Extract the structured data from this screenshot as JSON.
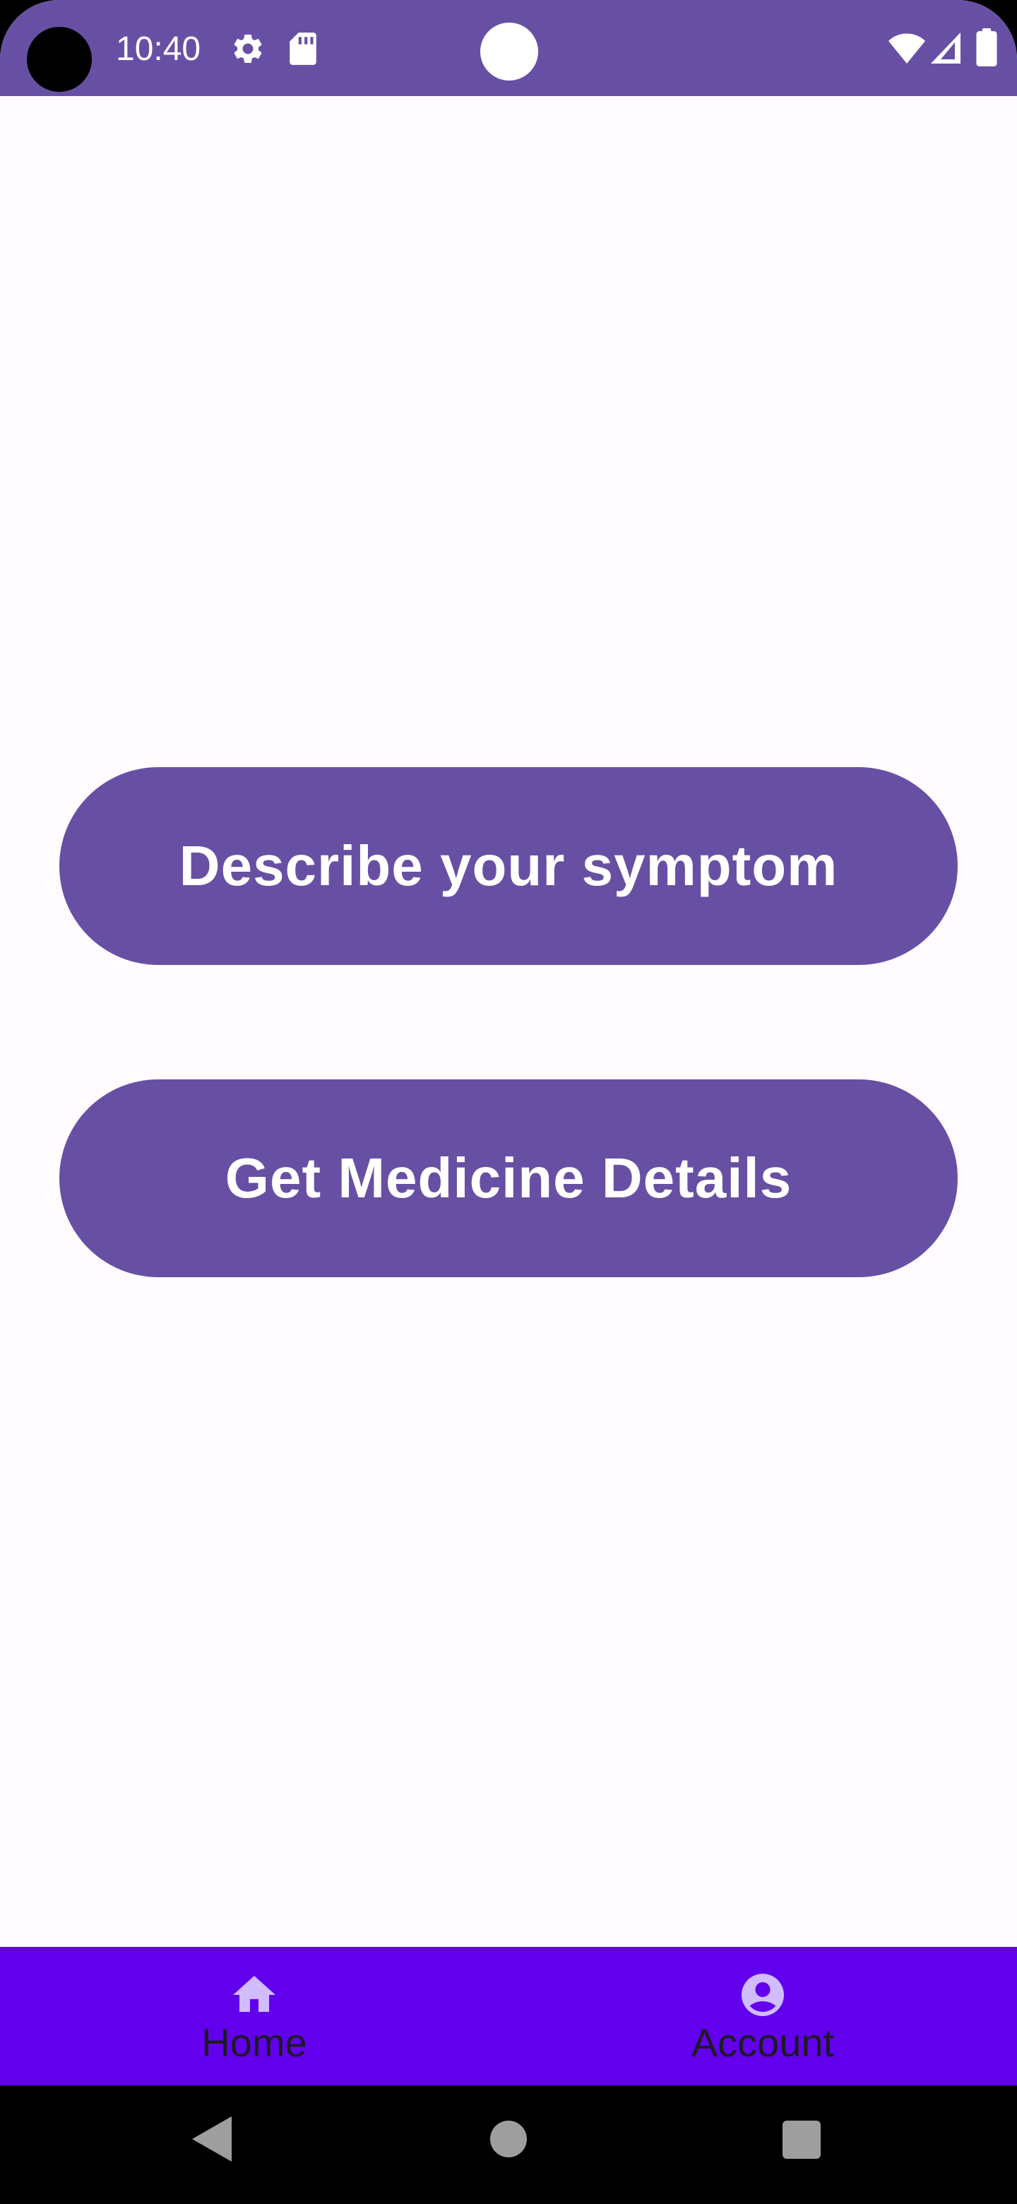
{
  "status_bar": {
    "time": "10:40",
    "icons": [
      "gear-icon",
      "sdcard-icon",
      "wifi-icon",
      "signal-icon",
      "battery-icon"
    ]
  },
  "main": {
    "buttons": [
      {
        "label": "Describe your symptom"
      },
      {
        "label": "Get Medicine Details"
      }
    ]
  },
  "bottom_nav": {
    "items": [
      {
        "label": "Home",
        "icon": "home-icon"
      },
      {
        "label": "Account",
        "icon": "account-icon"
      }
    ]
  },
  "system_nav": {
    "icons": [
      "back-icon",
      "home-circle-icon",
      "recents-icon"
    ]
  },
  "colors": {
    "primary": "#6750A4",
    "nav_bar": "#6200EE",
    "background": "#FFFBFE",
    "nav_icon": "#D0BCFF",
    "nav_label": "#1D1B20"
  }
}
